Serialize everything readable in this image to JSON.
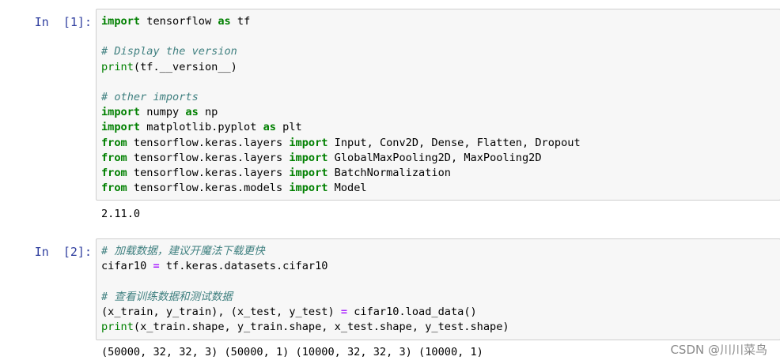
{
  "cells": [
    {
      "prompt": "In  [1]:",
      "code": [
        [
          {
            "t": "import",
            "c": "kw"
          },
          {
            "t": " tensorflow "
          },
          {
            "t": "as",
            "c": "kw"
          },
          {
            "t": " tf"
          }
        ],
        [],
        [
          {
            "t": "# Display the version",
            "c": "cm"
          }
        ],
        [
          {
            "t": "print",
            "c": "bi"
          },
          {
            "t": "(tf.__version__)"
          }
        ],
        [],
        [
          {
            "t": "# other imports",
            "c": "cm"
          }
        ],
        [
          {
            "t": "import",
            "c": "kw"
          },
          {
            "t": " numpy "
          },
          {
            "t": "as",
            "c": "kw"
          },
          {
            "t": " np"
          }
        ],
        [
          {
            "t": "import",
            "c": "kw"
          },
          {
            "t": " matplotlib.pyplot "
          },
          {
            "t": "as",
            "c": "kw"
          },
          {
            "t": " plt"
          }
        ],
        [
          {
            "t": "from",
            "c": "kw"
          },
          {
            "t": " tensorflow.keras.layers "
          },
          {
            "t": "import",
            "c": "kw"
          },
          {
            "t": " Input, Conv2D, Dense, Flatten, Dropout"
          }
        ],
        [
          {
            "t": "from",
            "c": "kw"
          },
          {
            "t": " tensorflow.keras.layers "
          },
          {
            "t": "import",
            "c": "kw"
          },
          {
            "t": " GlobalMaxPooling2D, MaxPooling2D"
          }
        ],
        [
          {
            "t": "from",
            "c": "kw"
          },
          {
            "t": " tensorflow.keras.layers "
          },
          {
            "t": "import",
            "c": "kw"
          },
          {
            "t": " BatchNormalization"
          }
        ],
        [
          {
            "t": "from",
            "c": "kw"
          },
          {
            "t": " tensorflow.keras.models "
          },
          {
            "t": "import",
            "c": "kw"
          },
          {
            "t": " Model"
          }
        ]
      ],
      "output": "2.11.0"
    },
    {
      "prompt": "In  [2]:",
      "code": [
        [
          {
            "t": "# 加载数据，建议开魔法下载更快",
            "c": "cm"
          }
        ],
        [
          {
            "t": "cifar10 "
          },
          {
            "t": "=",
            "c": "op"
          },
          {
            "t": " tf.keras.datasets.cifar10"
          }
        ],
        [],
        [
          {
            "t": "# 查看训练数据和测试数据",
            "c": "cm"
          }
        ],
        [
          {
            "t": "(x_train, y_train), (x_test, y_test) "
          },
          {
            "t": "=",
            "c": "op"
          },
          {
            "t": " cifar10.load_data()"
          }
        ],
        [
          {
            "t": "print",
            "c": "bi"
          },
          {
            "t": "(x_train.shape, y_train.shape, x_test.shape, y_test.shape)"
          }
        ]
      ],
      "output": "(50000, 32, 32, 3) (50000, 1) (10000, 32, 32, 3) (10000, 1)"
    }
  ],
  "watermark": "CSDN @川川菜鸟",
  "colors": {
    "prompt": "#303f9f",
    "keyword": "#008000",
    "comment": "#408080",
    "operator": "#aa22ff",
    "cell_bg": "#f7f7f7",
    "cell_border": "#cfcfcf"
  }
}
